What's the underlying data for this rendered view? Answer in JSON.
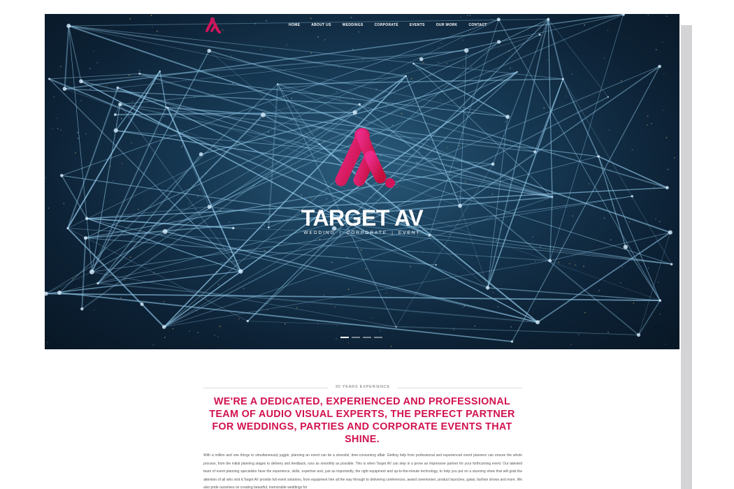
{
  "nav": {
    "items": [
      "HOME",
      "ABOUT US",
      "WEDDINGS",
      "CORPORATE",
      "EVENTS",
      "OUR WORK",
      "CONTACT"
    ],
    "logo_icon": "target-av-logo-icon"
  },
  "hero": {
    "brand_name": "TARGET AV",
    "tagline": [
      "WEDDING",
      "CORPORATE",
      "EVENT"
    ],
    "slides": 4,
    "active_slide": 1
  },
  "intro": {
    "kicker": "30 YEARS EXPERIENCE",
    "headline": "WE'RE A DEDICATED, EXPERIENCED AND PROFESSIONAL TEAM OF AUDIO VISUAL EXPERTS, THE PERFECT PARTNER FOR WEDDINGS, PARTIES AND CORPORATE EVENTS THAT SHINE.",
    "body": "With a million and one things to simultaneously juggle, planning an event can be a stressful, time-consuming affair. Getting help from professional and experienced event planners can ensure the whole process, from the initial planning stages to delivery and feedback, runs as smoothly as possible. This is when Target AV can step in a prove an impressive partner for your forthcoming event. Our talented team of event planning specialists have the experience, skills, expertise and, just as importantly, the right equipment and up-to-the-minute technology, to help you put on a stunning show that will grab the attention of all who visit it.Target AV provide full event solutions, from equipment hire all the way through to delivering conferences, award ceremonies, product launches, galas, fashion shows and more. We also pride ourselves on creating beautiful, memorable weddings for"
  },
  "colors": {
    "accent": "#d1124e",
    "hero_bg": "#0d2236",
    "network_lines": "#8fc6e6"
  }
}
